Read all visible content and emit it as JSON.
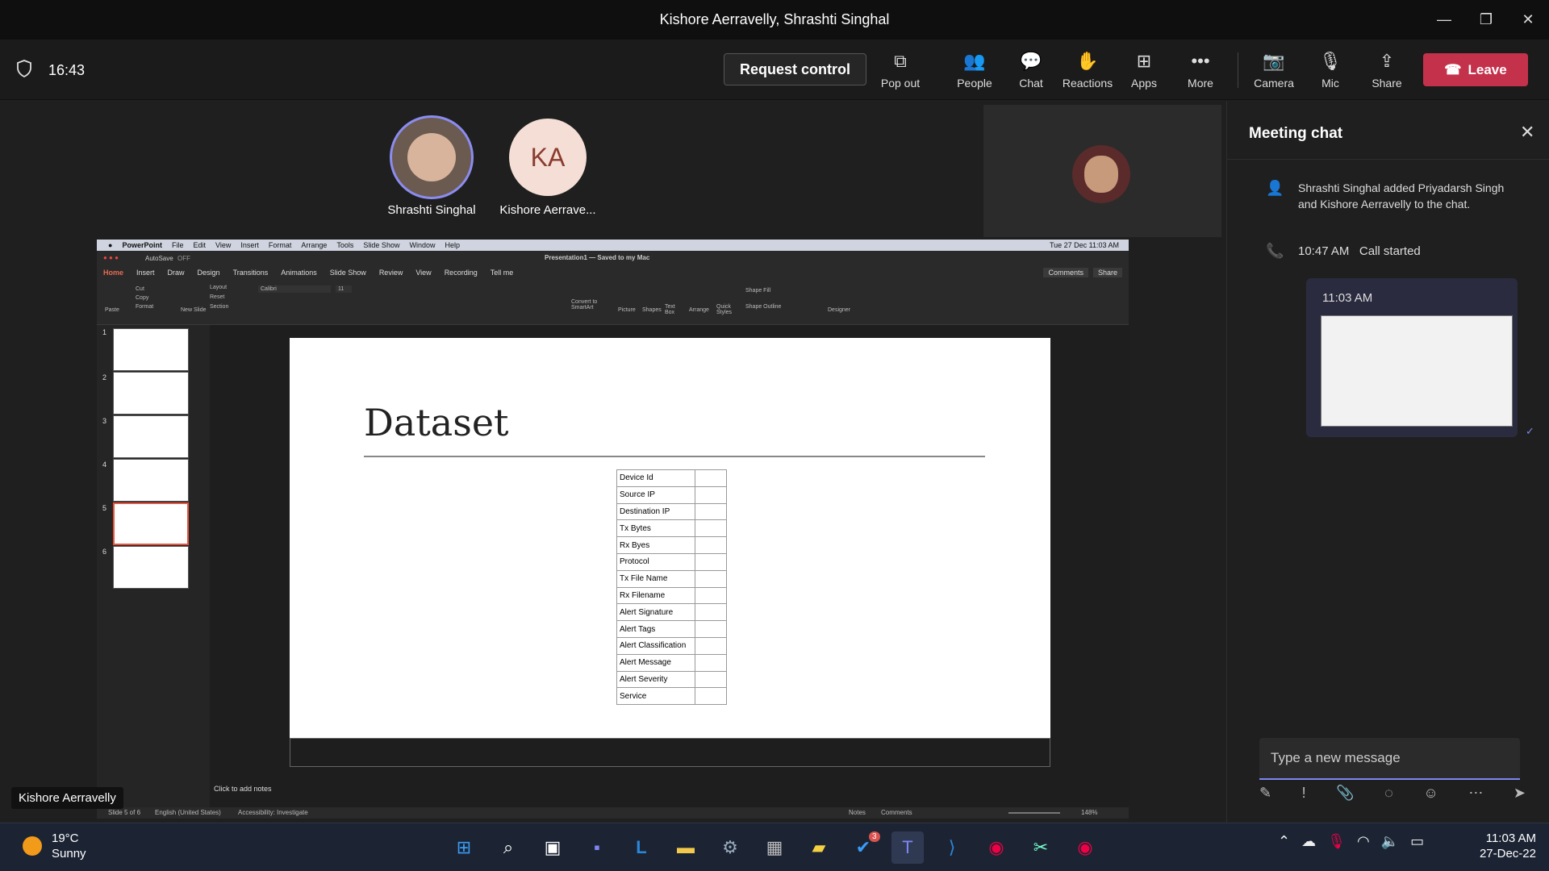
{
  "window": {
    "title": "Kishore Aerravelly, Shrashti Singhal"
  },
  "toolbar": {
    "time": "16:43",
    "request_control": "Request control",
    "buttons": {
      "popout": "Pop out",
      "people": "People",
      "chat": "Chat",
      "reactions": "Reactions",
      "apps": "Apps",
      "more": "More",
      "camera": "Camera",
      "mic": "Mic",
      "share": "Share"
    },
    "leave": "Leave"
  },
  "participants": [
    {
      "name": "Shrashti Singhal",
      "initials": ""
    },
    {
      "name": "Kishore Aerrave...",
      "initials": "KA"
    }
  ],
  "speaker_tag": "Kishore Aerravelly",
  "shared": {
    "macbar": {
      "app": "PowerPoint",
      "menus": [
        "File",
        "Edit",
        "View",
        "Insert",
        "Format",
        "Arrange",
        "Tools",
        "Slide Show",
        "Window",
        "Help"
      ],
      "datetime": "Tue 27 Dec 11:03 AM"
    },
    "doc_title": "Presentation1 — Saved to my Mac",
    "autosave": "AutoSave",
    "autosave_state": "OFF",
    "tabs": [
      "Home",
      "Insert",
      "Draw",
      "Design",
      "Transitions",
      "Animations",
      "Slide Show",
      "Review",
      "View",
      "Recording",
      "Tell me"
    ],
    "comments": "Comments",
    "share": "Share",
    "ribbon": {
      "paste": "Paste",
      "cut": "Cut",
      "copy": "Copy",
      "format": "Format",
      "new_slide": "New Slide",
      "layout": "Layout",
      "reset": "Reset",
      "section": "Section",
      "font": "Calibri",
      "size": "11",
      "convert": "Convert to SmartArt",
      "picture": "Picture",
      "shapes": "Shapes",
      "textbox": "Text Box",
      "arrange": "Arrange",
      "quick_styles": "Quick Styles",
      "shape_fill": "Shape Fill",
      "shape_outline": "Shape Outline",
      "designer": "Designer"
    },
    "slide_numbers": [
      "1",
      "2",
      "3",
      "4",
      "5",
      "6"
    ],
    "slide_title": "Dataset",
    "table_rows": [
      "Device Id",
      "Source IP",
      "Destination IP",
      "Tx Bytes",
      "Rx Byes",
      "Protocol",
      "Tx File Name",
      "Rx Filename",
      "Alert Signature",
      "Alert Tags",
      "Alert Classification",
      "Alert Message",
      "Alert Severity",
      "Service"
    ],
    "notes_placeholder": "Click to add notes",
    "status": {
      "slide": "Slide 5 of 6",
      "lang": "English (United States)",
      "access": "Accessibility: Investigate",
      "notes": "Notes",
      "comments": "Comments",
      "zoom": "148%"
    }
  },
  "chat": {
    "title": "Meeting chat",
    "system_msg": "Shrashti Singhal added Priyadarsh Singh and Kishore Aerravelly to the chat.",
    "call_time": "10:47 AM",
    "call_text": "Call started",
    "bubble_time": "11:03 AM",
    "compose_placeholder": "Type a new message"
  },
  "taskbar": {
    "temp": "19°C",
    "weather": "Sunny",
    "todo_badge": "3",
    "time": "11:03 AM",
    "date": "27-Dec-22"
  },
  "colors": {
    "leave": "#c4314b",
    "accent": "#7f85f5",
    "chat_bubble": "#2b2b40"
  }
}
